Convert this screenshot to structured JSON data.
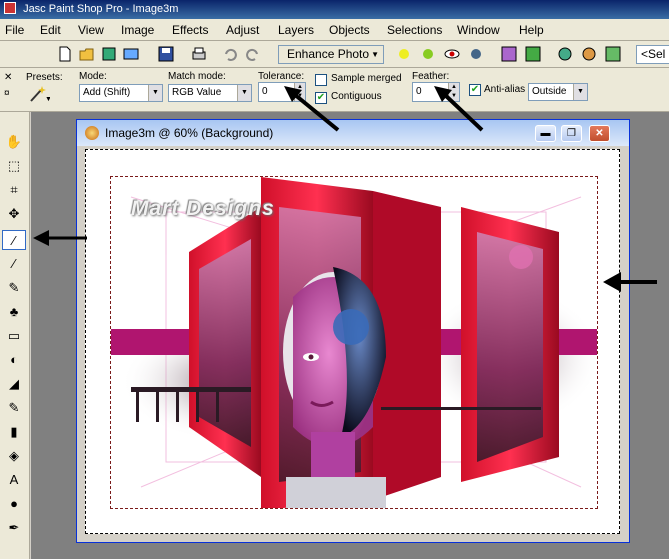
{
  "app": {
    "title": "Jasc Paint Shop Pro - Image3m"
  },
  "menu": [
    "File",
    "Edit",
    "View",
    "Image",
    "Effects",
    "Adjust",
    "Layers",
    "Objects",
    "Selections",
    "Window",
    "Help"
  ],
  "toolbar": {
    "enhance_label": "Enhance Photo",
    "sel_label": "<Sel"
  },
  "options": {
    "presets_label": "Presets:",
    "mode_label": "Mode:",
    "mode_value": "Add (Shift)",
    "match_label": "Match mode:",
    "match_value": "RGB Value",
    "tolerance_label": "Tolerance:",
    "tolerance_value": "0",
    "sample_merged": "Sample merged",
    "contiguous": "Contiguous",
    "feather_label": "Feather:",
    "feather_value": "0",
    "antialias": "Anti-alias",
    "outside_value": "Outside"
  },
  "document": {
    "title": "Image3m @  60% (Background)",
    "watermark": "Mart Designs"
  },
  "colors": {
    "accent_red": "#c8102e",
    "magenta_band": "#b0156f"
  }
}
